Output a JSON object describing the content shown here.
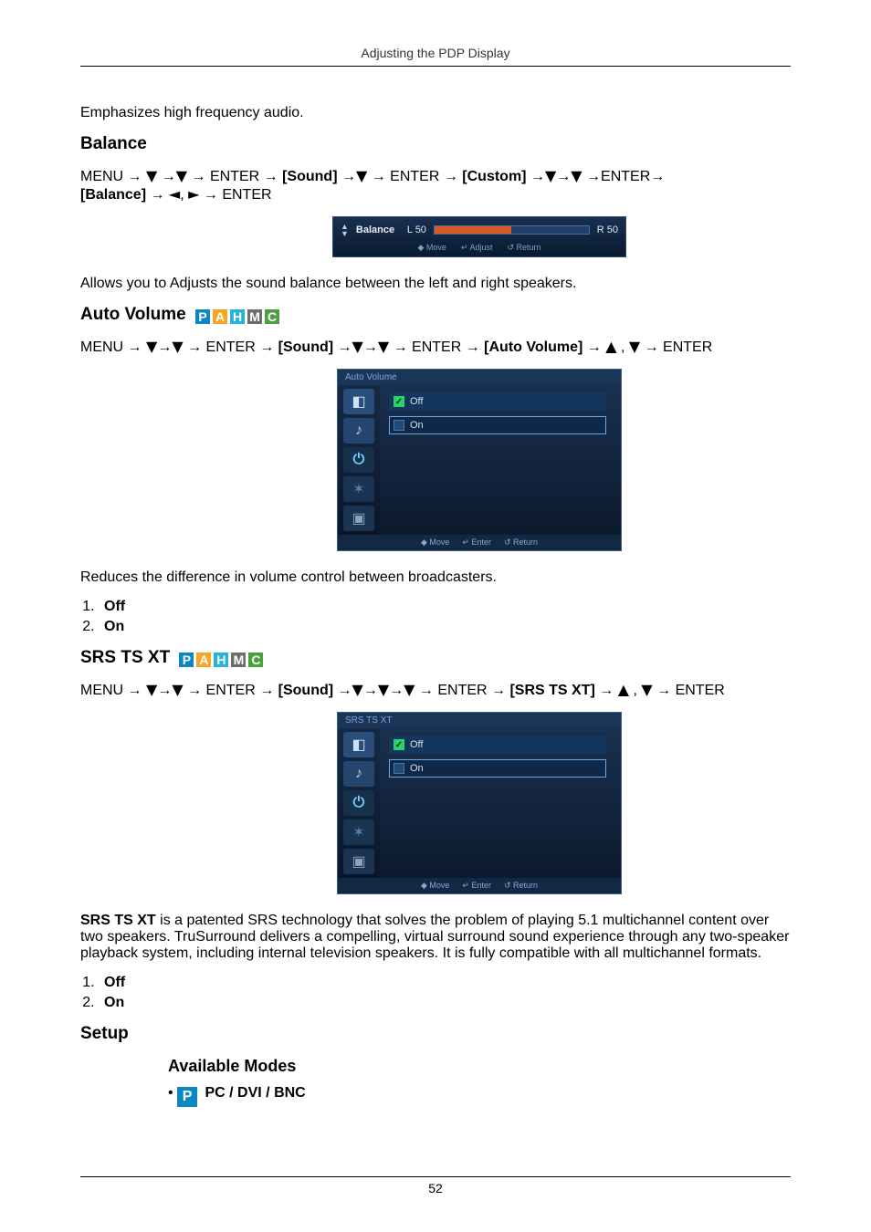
{
  "running_head": "Adjusting the PDP Display",
  "page_number": "52",
  "intro_prev": "Emphasizes high frequency audio.",
  "balance": {
    "heading": "Balance",
    "path_a": "MENU → ",
    "path_b": " → ENTER → ",
    "path_sound": "[Sound]",
    "path_c": " → ENTER → ",
    "path_custom": "[Custom]",
    "path_d": " →ENTER→ ",
    "path_balance": "[Balance]",
    "path_e": " → ENTER",
    "osd_label": "Balance",
    "osd_left": "L 50",
    "osd_right": "R 50",
    "osd_hints_move": "Move",
    "osd_hints_adjust": "Adjust",
    "osd_hints_return": "Return",
    "desc": "Allows you to Adjusts the sound balance between the left and right speakers."
  },
  "autovol": {
    "heading": "Auto Volume",
    "path_a": "MENU → ",
    "path_b": " → ENTER → ",
    "path_sound": "[Sound]",
    "path_c": " → ENTER → ",
    "path_auto": "[Auto Volume]",
    "path_d": " → ENTER",
    "osd_title": "Auto Volume",
    "opt_off": "Off",
    "opt_on": "On",
    "hints_move": "Move",
    "hints_enter": "Enter",
    "hints_return": "Return",
    "desc": "Reduces the difference in volume control between broadcasters.",
    "li1": "Off",
    "li2": "On"
  },
  "srs": {
    "heading": "SRS TS XT",
    "path_a": "MENU → ",
    "path_b": " → ENTER → ",
    "path_sound": "[Sound]",
    "path_c": " → ENTER → ",
    "path_item": "[SRS TS XT]",
    "path_d": " → ENTER",
    "osd_title": "SRS TS XT",
    "opt_off": "Off",
    "opt_on": "On",
    "hints_move": "Move",
    "hints_enter": "Enter",
    "hints_return": "Return",
    "desc_lead": "SRS TS XT",
    "desc_rest": " is a patented SRS technology that solves the problem of playing 5.1 multichannel content over two speakers. TruSurround delivers a compelling, virtual surround sound experience through any two-speaker playback system, including internal television speakers. It is fully compatible with all multichannel formats.",
    "li1": "Off",
    "li2": "On"
  },
  "setup": {
    "heading": "Setup",
    "sub": "Available Modes",
    "mode_p_label": "P",
    "mode_p_text": " PC / DVI / BNC"
  },
  "badges": {
    "P": "P",
    "A": "A",
    "H": "H",
    "M": "M",
    "C": "C"
  },
  "glyphs": {
    "down": "▼",
    "up": "▲",
    "left": "◄",
    "right": "►",
    "arrow": "→",
    "arrows": "▼→▼",
    "enter_icon": "↵",
    "return_icon": "↺",
    "move_icon": "◆",
    "adjust_icon": "↔"
  }
}
